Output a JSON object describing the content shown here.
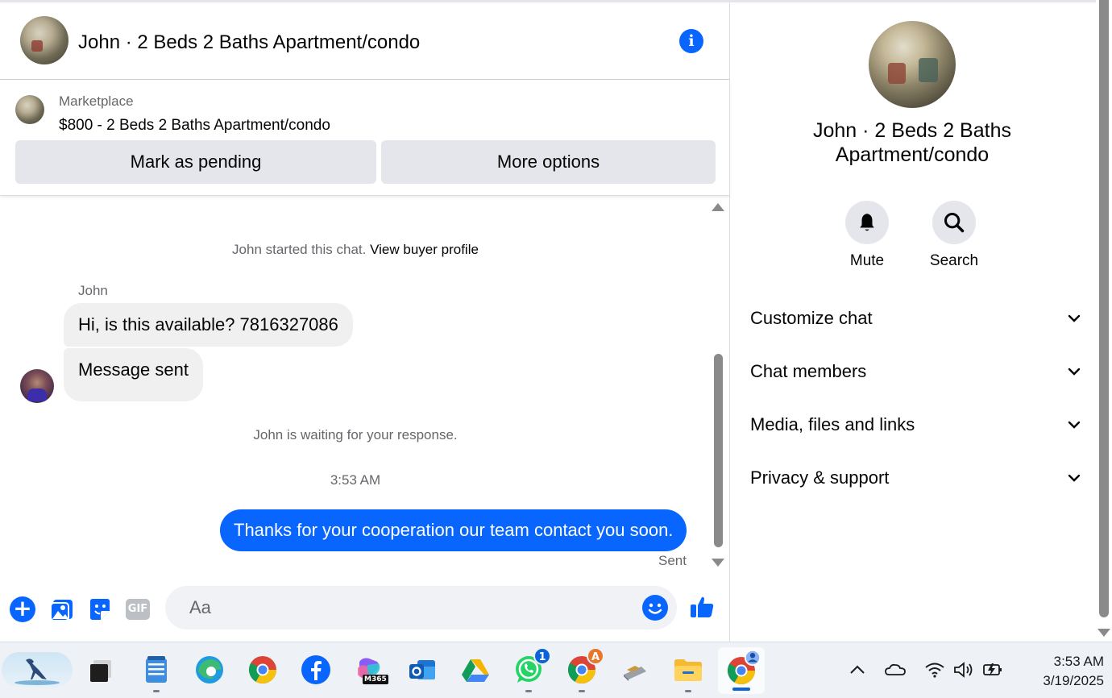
{
  "chat": {
    "title": "John · 2 Beds 2 Baths Apartment/condo",
    "listing": {
      "source": "Marketplace",
      "name": "$800 - 2 Beds 2 Baths Apartment/condo",
      "pending_label": "Mark as pending",
      "more_label": "More options"
    },
    "messages": {
      "started_prefix": "John started this chat.",
      "view_profile": "View buyer profile",
      "sender_name": "John",
      "incoming": [
        "Hi, is this available? 7816327086",
        "Message sent"
      ],
      "waiting": "John is waiting for your response.",
      "time": "3:53 AM",
      "outgoing": "Thanks for your cooperation our team contact you soon.",
      "status": "Sent"
    },
    "composer": {
      "placeholder": "Aa",
      "gif_label": "GIF"
    },
    "colors": {
      "accent": "#0866ff",
      "bubble_in": "#f0f0f0"
    }
  },
  "sidebar": {
    "title": "John · 2 Beds 2 Baths Apartment/condo",
    "actions": [
      {
        "icon": "bell-icon",
        "label": "Mute"
      },
      {
        "icon": "search-icon",
        "label": "Search"
      }
    ],
    "sections": [
      "Customize chat",
      "Chat members",
      "Media, files and links",
      "Privacy & support"
    ]
  },
  "taskbar": {
    "apps": [
      "heron-widget",
      "task-view",
      "notepad",
      "edge",
      "chrome",
      "facebook",
      "m365-copilot",
      "outlook",
      "google-drive",
      "whatsapp",
      "chrome-profile",
      "usb-drive",
      "file-explorer",
      "chrome-active"
    ],
    "whatsapp_badge": "1",
    "chrome_badge": "A",
    "m365_label": "M365",
    "time": "3:53 AM",
    "date": "3/19/2025"
  }
}
